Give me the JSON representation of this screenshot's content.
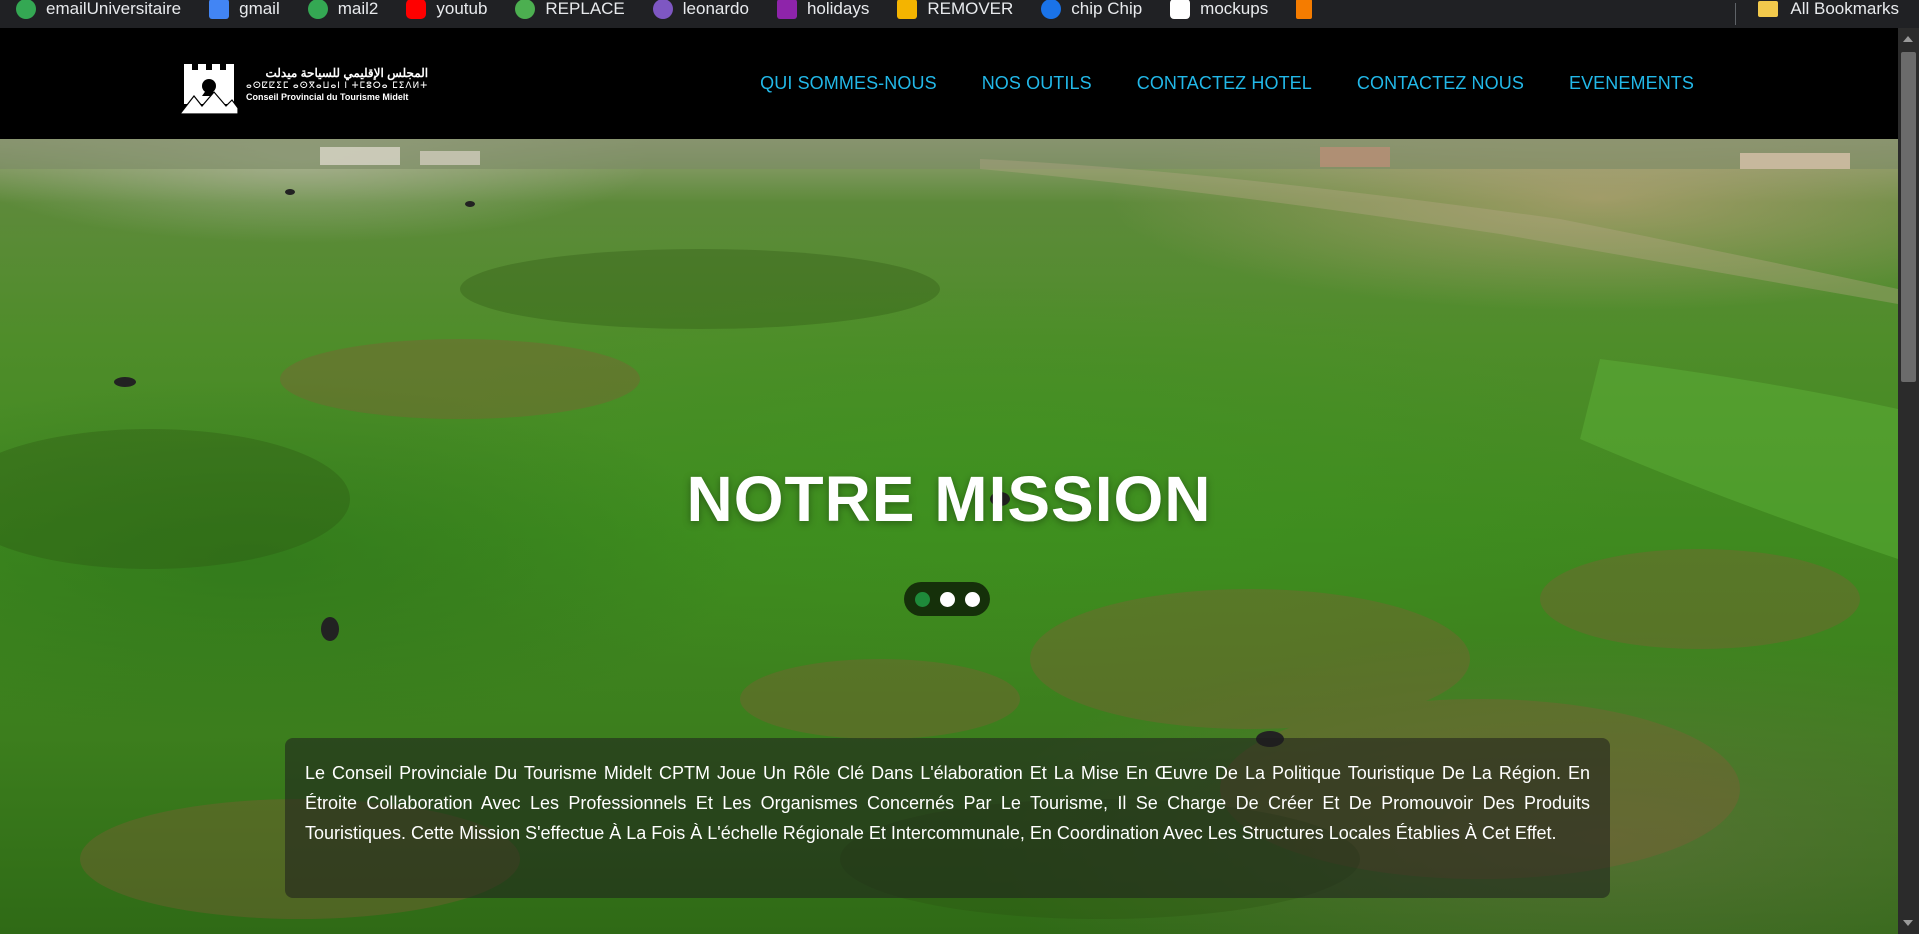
{
  "bookmarks": {
    "items": [
      {
        "label": "emailUniversitaire",
        "icon": "chrome-icon",
        "color": "#34a853"
      },
      {
        "label": "gmail",
        "icon": "gmail-icon",
        "color": "#4285f4"
      },
      {
        "label": "mail2",
        "icon": "chrome-icon",
        "color": "#34a853"
      },
      {
        "label": "youtub",
        "icon": "youtube-icon",
        "color": "#ff0000"
      },
      {
        "label": "REPLACE",
        "icon": "replace-icon",
        "color": "#4caf50"
      },
      {
        "label": "leonardo",
        "icon": "leonardo-icon",
        "color": "#7e57c2"
      },
      {
        "label": "holidays",
        "icon": "holidays-icon",
        "color": "#8e24aa"
      },
      {
        "label": "REMOVER",
        "icon": "remover-icon",
        "color": "#f4b400"
      },
      {
        "label": "chip Chip",
        "icon": "chip-icon",
        "color": "#1a73e8"
      },
      {
        "label": "mockups",
        "icon": "mockups-icon",
        "color": "#ffffff"
      },
      {
        "label": "",
        "icon": "chart-icon",
        "color": "#f57c00"
      }
    ],
    "all_bookmarks": "All Bookmarks"
  },
  "header": {
    "logo": {
      "arabic": "المجلس الإقليمي للسياحة ميدلت",
      "tifinagh": "ⴰⵙⵇⵇⵉⵎ ⴰⵙⴳⴰⵡⴰⵏ ⵏ ⵜⵎⵓⵔⴰ ⵎⵉⴷⵍⵜ",
      "french": "Conseil Provincial du Tourisme Midelt"
    },
    "nav": [
      {
        "label": "QUI SOMMES-NOUS"
      },
      {
        "label": "NOS OUTILS"
      },
      {
        "label": "CONTACTEZ HOTEL"
      },
      {
        "label": "CONTACTEZ NOUS"
      },
      {
        "label": "EVENEMENTS"
      }
    ],
    "nav_color": "#22b8e8"
  },
  "hero": {
    "title": "NOTRE MISSION",
    "slides_total": 3,
    "active_slide": 1,
    "active_dot_color": "#1e8a3a",
    "description": "Le Conseil Provinciale Du Tourisme Midelt CPTM Joue Un Rôle Clé Dans L'élaboration Et La Mise En Œuvre De La Politique Touristique De La Région. En Étroite Collaboration Avec Les Professionnels Et Les Organismes Concernés Par Le Tourisme, Il Se Charge De Créer Et De Promouvoir Des Produits Touristiques. Cette Mission S'effectue À La Fois À L'échelle Régionale Et Intercommunale, En Coordination Avec Les Structures Locales Établies À Cet Effet."
  }
}
